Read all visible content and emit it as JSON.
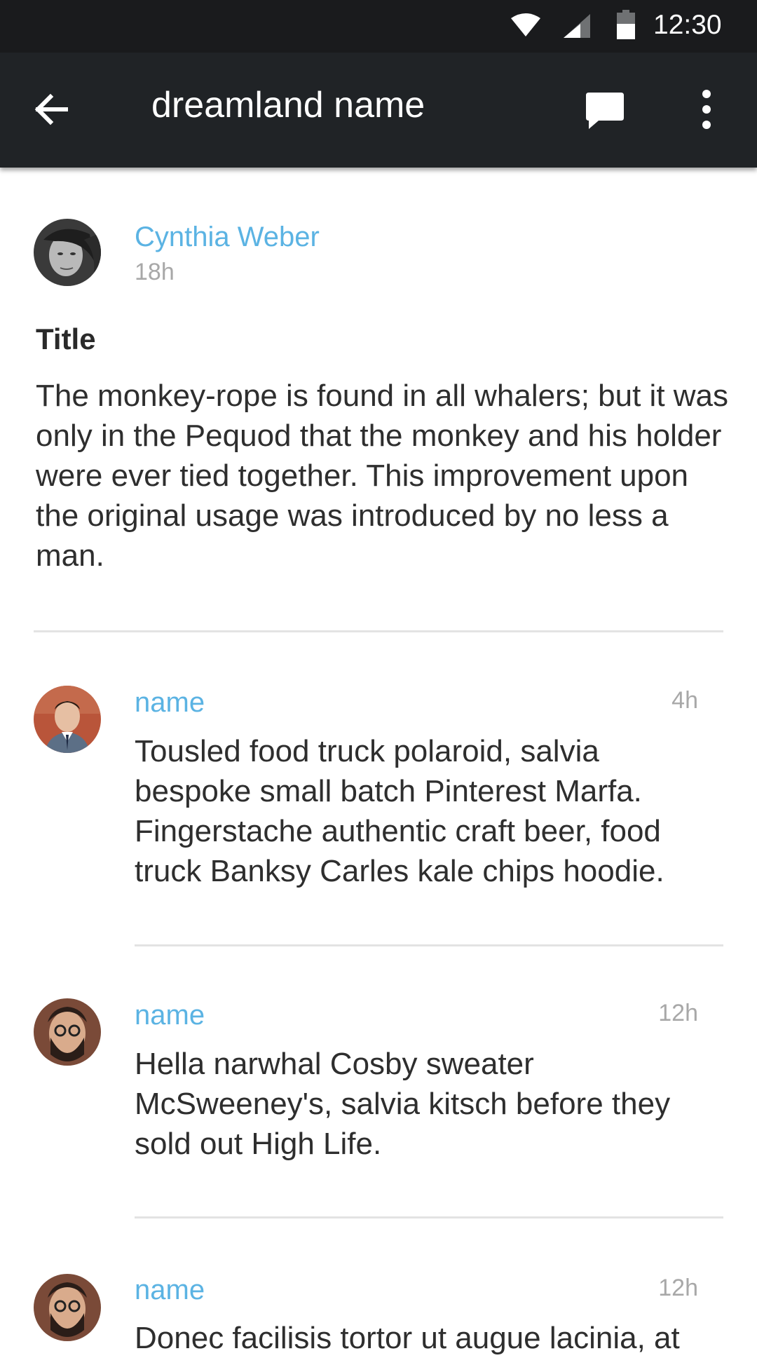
{
  "status_bar": {
    "time": "12:30",
    "icons": [
      "wifi-icon",
      "cell-signal-icon",
      "battery-icon"
    ]
  },
  "app_bar": {
    "title": "dreamland name",
    "icons": [
      "back-arrow-icon",
      "chat-icon",
      "more-vert-icon"
    ]
  },
  "post": {
    "author": "Cynthia Weber",
    "time": "18h",
    "title": "Title",
    "body": "The monkey-rope is found in all whalers; but it was only in the Pequod that the monkey and his holder were ever tied together. This improvement upon the original usage was introduced by no less a man."
  },
  "comments": [
    {
      "name": "name",
      "time": "4h",
      "text": "Tousled food truck polaroid, salvia bespoke small batch Pinterest Marfa. Fingerstache authentic craft beer, food truck Banksy Carles kale chips hoodie."
    },
    {
      "name": "name",
      "time": "12h",
      "text": "Hella narwhal Cosby sweater McSweeney's, salvia kitsch before they sold out High Life."
    },
    {
      "name": "name",
      "time": "12h",
      "text": "Donec facilisis tortor ut augue lacinia, at"
    }
  ],
  "colors": {
    "status_bar": "#1a1b1d",
    "app_bar": "#202326",
    "accent_name": "#5bb3e3",
    "timestamp": "#a8a8a8",
    "divider": "#e3e3e3"
  }
}
